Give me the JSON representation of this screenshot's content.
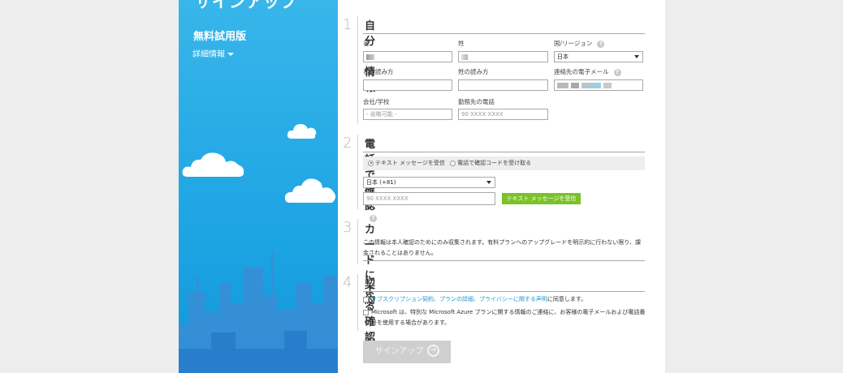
{
  "sidebar": {
    "title": "サインアップ",
    "subtitle": "無料試用版",
    "details_link": "詳細情報"
  },
  "sections": {
    "s1": {
      "number": "1",
      "title": "自分の情報",
      "first_name_label": "名",
      "last_name_label": "姓",
      "country_label": "国/リージョン",
      "country_value": "日本",
      "first_name_reading_label": "名の読み方",
      "last_name_reading_label": "姓の読み方",
      "email_label": "連絡先の電子メール",
      "company_label": "会社/学校",
      "company_placeholder": "- 省略可能 -",
      "work_phone_label": "勤務先の電話",
      "work_phone_placeholder": "90 XXXX XXXX"
    },
    "s2": {
      "number": "2",
      "title": "電話で確認",
      "radio_text": "テキスト メッセージを受信",
      "radio_call": "電話で確認コードを受け取る",
      "country_code_value": "日本 (+81)",
      "phone_placeholder": "90 XXXX XXXX",
      "send_button": "テキスト メッセージを受信"
    },
    "s3": {
      "number": "3",
      "title": "カードによる確認",
      "description_line1": "この情報は本人確認のためにのみ収集されます。有料プランへのアップグレードを明示的に行わない限り、課",
      "description_line2": "金されることはありません。"
    },
    "s4": {
      "number": "4",
      "title": "契約",
      "agree_link": "サブスクリプション契約、プランの詳細、プライバシーに関する声明",
      "agree_suffix": "に同意します。",
      "optin_line1": "Microsoft は、特別な Microsoft Azure プランに関する情報のご連絡に、お客様の電子メールおよび電話番",
      "optin_line2": "号を使用する場合があります。"
    }
  },
  "signup_button": "サインアップ",
  "colors": {
    "sidebar_blue": "#1aa2e2",
    "accent_green": "#7ac226",
    "link_blue": "#1a9ad6"
  }
}
